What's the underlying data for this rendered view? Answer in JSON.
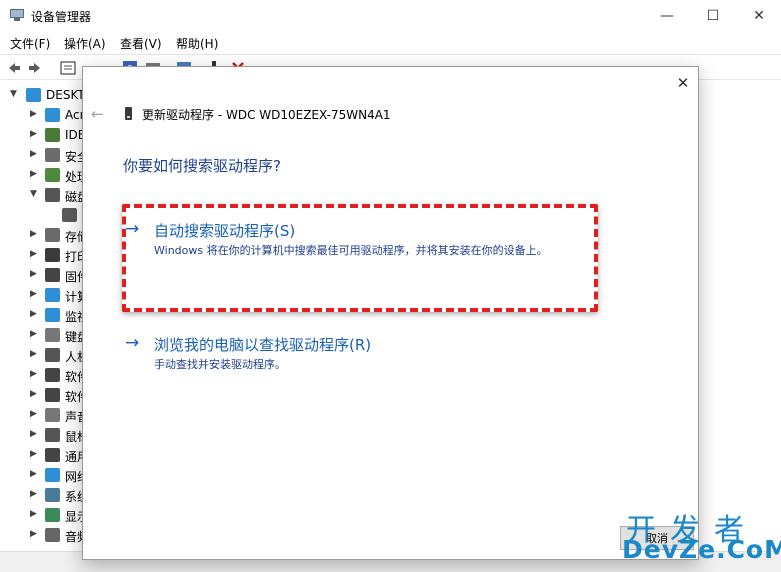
{
  "window": {
    "title": "设备管理器",
    "minimize_glyph": "—",
    "maximize_glyph": "☐",
    "close_glyph": "✕"
  },
  "menu": {
    "items": [
      {
        "label": "文件(F)"
      },
      {
        "label": "操作(A)"
      },
      {
        "label": "查看(V)"
      },
      {
        "label": "帮助(H)"
      }
    ]
  },
  "toolbar": {
    "icons": [
      "back-arrow-icon",
      "forward-arrow-icon",
      "properties-icon",
      "help-icon",
      "view-icon",
      "monitor-icon",
      "device-icon",
      "uninstall-x-icon"
    ]
  },
  "tree": {
    "root": "DESKT",
    "items": [
      {
        "label": "Acr",
        "icon": "audio-input-icon",
        "color": "#2f8fd6",
        "expanded": false
      },
      {
        "label": "IDE",
        "icon": "ide-controller-icon",
        "color": "#4a7a3a",
        "expanded": false
      },
      {
        "label": "安全",
        "icon": "security-device-icon",
        "color": "#6c6c6c",
        "expanded": false
      },
      {
        "label": "处理",
        "icon": "processor-icon",
        "color": "#4f8a3b",
        "expanded": false
      },
      {
        "label": "磁盘",
        "icon": "disk-drive-icon",
        "color": "#555555",
        "expanded": true
      },
      {
        "label": "",
        "icon": "disk-icon",
        "color": "#5a5a5a",
        "expanded": null
      },
      {
        "label": "存储",
        "icon": "storage-controller-icon",
        "color": "#6a6a6a",
        "expanded": false
      },
      {
        "label": "打印",
        "icon": "printer-icon",
        "color": "#3b3b3b",
        "expanded": false
      },
      {
        "label": "固件",
        "icon": "firmware-icon",
        "color": "#444444",
        "expanded": false
      },
      {
        "label": "计算",
        "icon": "computer-icon",
        "color": "#2f8fd6",
        "expanded": false
      },
      {
        "label": "监视",
        "icon": "monitor-icon",
        "color": "#2f8fd6",
        "expanded": false
      },
      {
        "label": "键盘",
        "icon": "keyboard-icon",
        "color": "#777777",
        "expanded": false
      },
      {
        "label": "人机",
        "icon": "hid-icon",
        "color": "#555555",
        "expanded": false
      },
      {
        "label": "软件",
        "icon": "software-component-icon",
        "color": "#444444",
        "expanded": false
      },
      {
        "label": "软件",
        "icon": "software-device-icon",
        "color": "#444444",
        "expanded": false
      },
      {
        "label": "声音",
        "icon": "sound-icon",
        "color": "#777777",
        "expanded": false
      },
      {
        "label": "鼠标",
        "icon": "mouse-icon",
        "color": "#555555",
        "expanded": false
      },
      {
        "label": "通用",
        "icon": "usb-icon",
        "color": "#444444",
        "expanded": false
      },
      {
        "label": "网络",
        "icon": "network-icon",
        "color": "#2f8fd6",
        "expanded": false
      },
      {
        "label": "系统",
        "icon": "system-device-icon",
        "color": "#4a7a9a",
        "expanded": false
      },
      {
        "label": "显示",
        "icon": "display-adapter-icon",
        "color": "#3a8a5a",
        "expanded": false
      },
      {
        "label": "音频",
        "icon": "audio-icon",
        "color": "#666666",
        "expanded": false
      }
    ]
  },
  "dialog": {
    "close_glyph": "✕",
    "back_glyph": "←",
    "header": "更新驱动程序 - WDC WD10EZEX-75WN4A1",
    "question": "你要如何搜索驱动程序?",
    "options": [
      {
        "arrow": "→",
        "title": "自动搜索驱动程序(S)",
        "desc": "Windows 将在你的计算机中搜索最佳可用驱动程序，并将其安装在你的设备上。"
      },
      {
        "arrow": "→",
        "title": "浏览我的电脑以查找驱动程序(R)",
        "desc": "手动查找并安装驱动程序。"
      }
    ],
    "cancel_label": "取消",
    "highlight_color": "#e02020"
  },
  "watermark": {
    "top": "开发者",
    "bottom": "DevZe.CoM"
  },
  "colors": {
    "link_blue": "#1560b8",
    "heading_blue": "#1e3f8f",
    "watermark_blue": "#1a88c9"
  }
}
